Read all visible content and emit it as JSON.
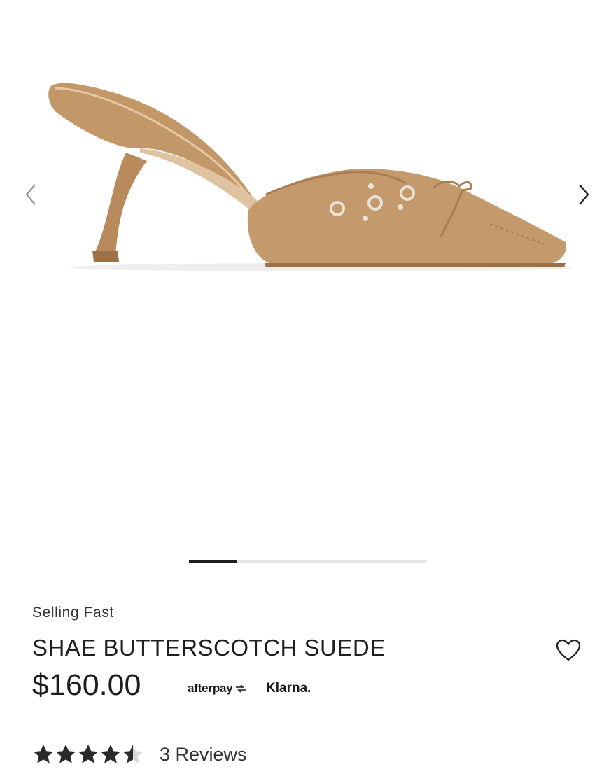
{
  "gallery": {
    "image_alt": "Shae Butterscotch Suede mule",
    "prev_icon": "chevron-left-icon",
    "next_icon": "chevron-right-icon",
    "progress_fraction": 0.2
  },
  "product": {
    "badge": "Selling Fast",
    "title": "SHAE BUTTERSCOTCH SUEDE",
    "price": "$160.00",
    "wishlist_icon": "heart-outline-icon"
  },
  "payment": {
    "afterpay": "afterpay",
    "klarna": "Klarna."
  },
  "rating": {
    "stars": 4.5,
    "max_stars": 5,
    "reviews_label": "3 Reviews"
  },
  "colors": {
    "suede": "#c49a6c",
    "suede_dark": "#a97f52",
    "accent_dark": "#1e1e1e"
  }
}
